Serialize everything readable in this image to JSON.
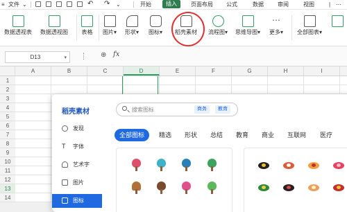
{
  "menubar": {
    "file": "文件",
    "start": "开始",
    "insert": "插入",
    "page_layout": "页面布局",
    "formula": "公式",
    "data": "数据",
    "review": "审阅",
    "view": "视图",
    "active_color": "#2f7d4f"
  },
  "ribbon": {
    "pivot_table": "数据透视表",
    "pivot_chart": "数据透视图",
    "table": "表格",
    "picture": "图片",
    "shape": "形状",
    "icon": "图标",
    "daoke": "稻壳素材",
    "flowchart": "流程图",
    "mindmap": "思维导图",
    "more": "更多",
    "all_charts": "全部图表"
  },
  "formula_bar": {
    "name_box": "D13",
    "fx": "fx"
  },
  "grid": {
    "columns": [
      "A",
      "B",
      "C",
      "D",
      "E",
      "F",
      "G",
      "H",
      "I"
    ],
    "selected_column": "D",
    "rows": [
      "1",
      "2",
      "3",
      "4",
      "5",
      "6",
      "7",
      "8",
      "9",
      "10",
      "11",
      "12",
      "13",
      "14"
    ],
    "selected_row": "13"
  },
  "dialog": {
    "title": "稻壳素材",
    "search_placeholder": "搜索图标",
    "chip_business": "商务",
    "chip_education": "教育",
    "side_items": [
      {
        "label": "发现",
        "icon": "compass-icon"
      },
      {
        "label": "字体",
        "icon": "font-icon"
      },
      {
        "label": "艺术字",
        "icon": "art-text-icon"
      },
      {
        "label": "图片",
        "icon": "image-icon"
      },
      {
        "label": "图标",
        "icon": "icon-library-icon"
      }
    ],
    "tabs": [
      "全部图标",
      "精选",
      "形状",
      "总结",
      "教育",
      "商业",
      "互联网",
      "医疗"
    ],
    "accent": "#1f6ae0"
  }
}
